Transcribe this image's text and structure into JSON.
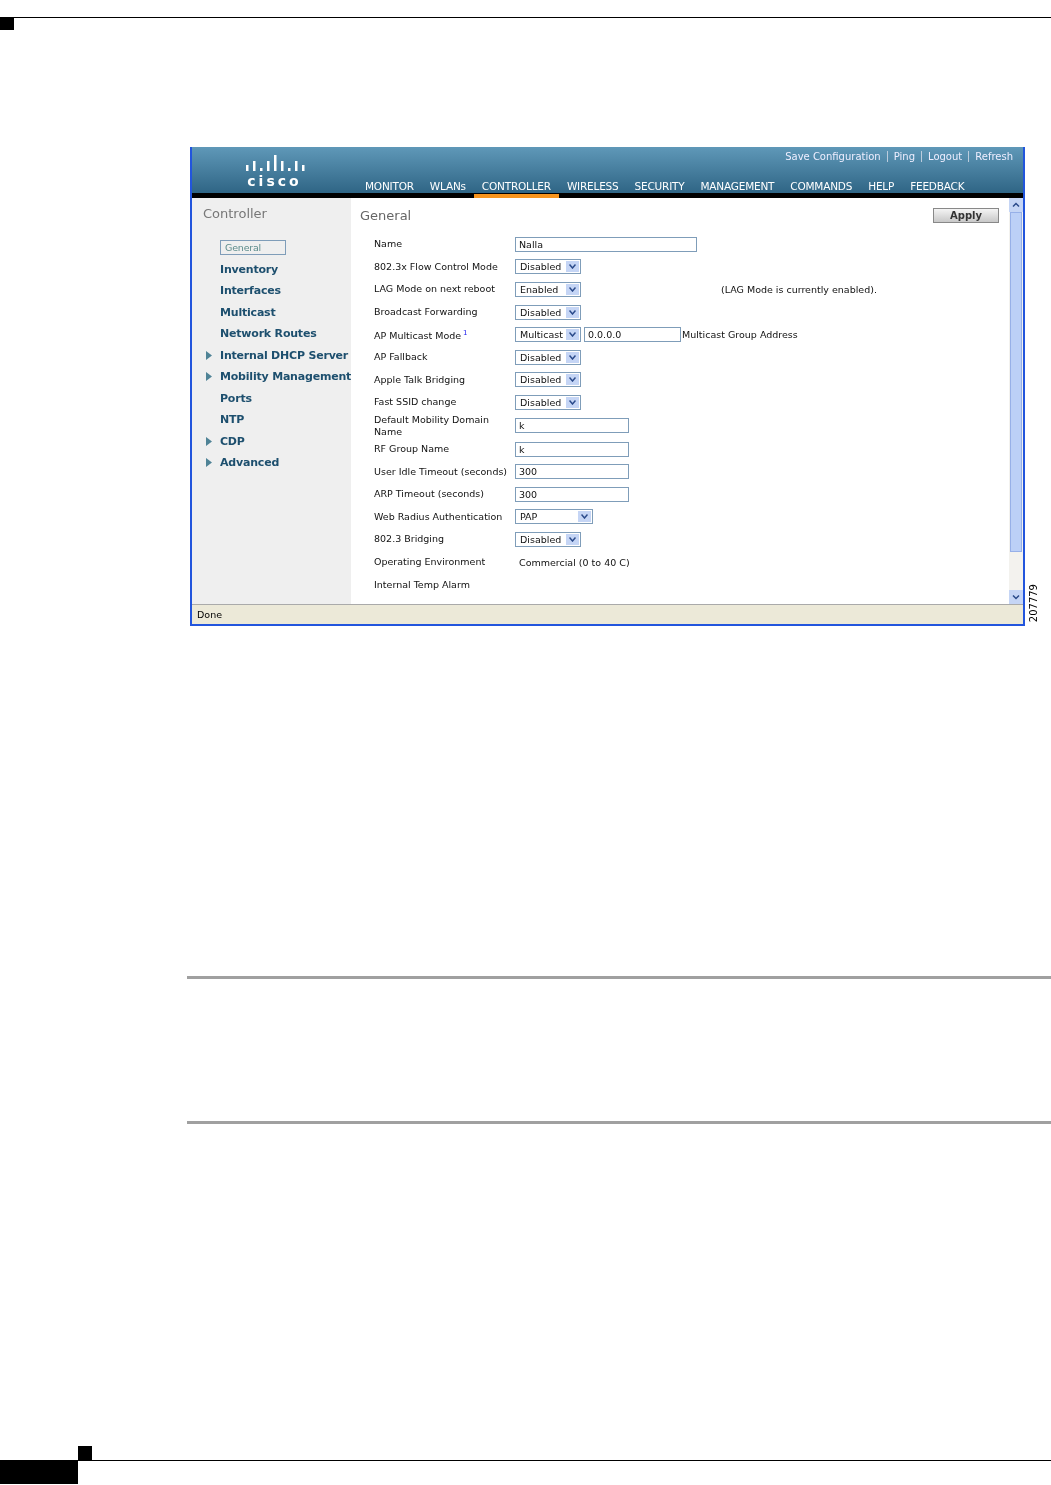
{
  "figure": {
    "logo": {
      "text": "cisco"
    },
    "top_links": [
      {
        "label": "Save Configuration"
      },
      {
        "label": "Ping"
      },
      {
        "label": "Logout"
      },
      {
        "label": "Refresh"
      }
    ],
    "nav": [
      {
        "label": "MONITOR",
        "selected": false
      },
      {
        "label": "WLANs",
        "selected": false
      },
      {
        "label": "CONTROLLER",
        "selected": true
      },
      {
        "label": "WIRELESS",
        "selected": false
      },
      {
        "label": "SECURITY",
        "selected": false
      },
      {
        "label": "MANAGEMENT",
        "selected": false
      },
      {
        "label": "COMMANDS",
        "selected": false
      },
      {
        "label": "HELP",
        "selected": false
      },
      {
        "label": "FEEDBACK",
        "selected": false
      }
    ],
    "sidebar": {
      "title": "Controller",
      "items": [
        {
          "label": "General",
          "kind": "page",
          "selected": true
        },
        {
          "label": "Inventory",
          "kind": "page",
          "selected": false
        },
        {
          "label": "Interfaces",
          "kind": "page",
          "selected": false
        },
        {
          "label": "Multicast",
          "kind": "page",
          "selected": false
        },
        {
          "label": "Network Routes",
          "kind": "page",
          "selected": false
        },
        {
          "label": "Internal DHCP Server",
          "kind": "folder",
          "selected": false
        },
        {
          "label": "Mobility Management",
          "kind": "folder",
          "selected": false
        },
        {
          "label": "Ports",
          "kind": "page",
          "selected": false
        },
        {
          "label": "NTP",
          "kind": "page",
          "selected": false
        },
        {
          "label": "CDP",
          "kind": "folder",
          "selected": false
        },
        {
          "label": "Advanced",
          "kind": "folder",
          "selected": false
        }
      ]
    },
    "main": {
      "title": "General",
      "apply_button": "Apply",
      "rows": [
        {
          "label": "Name",
          "kind": "text",
          "value": "Nalla",
          "wide": true
        },
        {
          "label": "802.3x Flow Control Mode",
          "kind": "select",
          "value": "Disabled"
        },
        {
          "label": "LAG Mode on next reboot",
          "kind": "select",
          "value": "Enabled",
          "note": "(LAG Mode is currently enabled)."
        },
        {
          "label": "Broadcast Forwarding",
          "kind": "select",
          "value": "Disabled"
        },
        {
          "label": "AP Multicast Mode",
          "footnote": "1",
          "kind": "select_field",
          "value": "Multicast",
          "field_value": "0.0.0.0",
          "field_label": "Multicast Group Address"
        },
        {
          "label": "AP Fallback",
          "kind": "select",
          "value": "Disabled"
        },
        {
          "label": "Apple Talk Bridging",
          "kind": "select",
          "value": "Disabled"
        },
        {
          "label": "Fast SSID change",
          "kind": "select",
          "value": "Disabled"
        },
        {
          "label": "Default Mobility Domain Name",
          "kind": "text",
          "value": "k",
          "wide": false
        },
        {
          "label": "RF Group Name",
          "kind": "text",
          "value": "k",
          "wide": false
        },
        {
          "label": "User Idle Timeout (seconds)",
          "kind": "text",
          "value": "300",
          "wide": false
        },
        {
          "label": "ARP Timeout (seconds)",
          "kind": "text",
          "value": "300",
          "wide": false
        },
        {
          "label": "Web Radius Authentication",
          "kind": "select_wide",
          "value": "PAP"
        },
        {
          "label": "802.3 Bridging",
          "kind": "select",
          "value": "Disabled"
        },
        {
          "label": "Operating Environment",
          "kind": "static",
          "value": "Commercial (0 to 40 C)"
        },
        {
          "label": "Internal Temp Alarm",
          "kind": "static_cut"
        }
      ]
    },
    "status_bar": "Done"
  },
  "figure_number": "207779"
}
